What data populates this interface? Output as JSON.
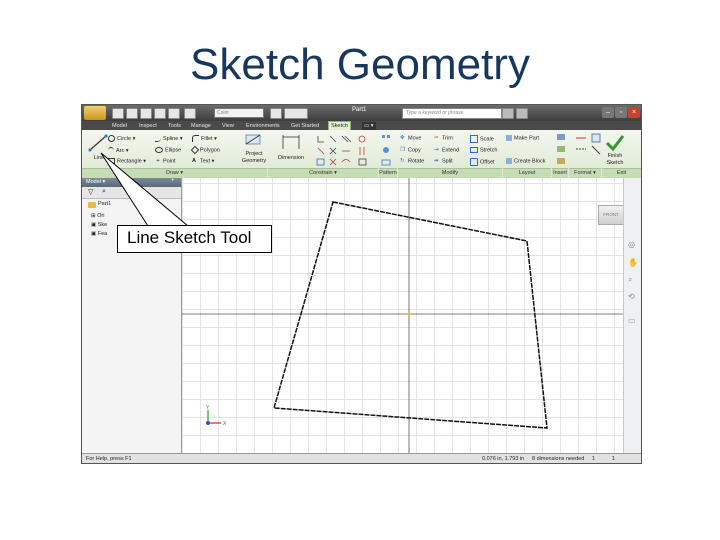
{
  "slide": {
    "title": "Sketch Geometry"
  },
  "app": {
    "doc_title": "Part1",
    "style_combo": "Color",
    "search_placeholder": "Type a keyword or phrase",
    "tabs": [
      "Model",
      "Inspect",
      "Tools",
      "Manage",
      "View",
      "Environments",
      "Get Started",
      "Sketch"
    ],
    "active_tab": "Sketch"
  },
  "ribbon": {
    "draw": {
      "line": "Line",
      "circle": "Circle",
      "arc": "Arc",
      "rectangle": "Rectangle",
      "spline": "Spline",
      "ellipse": "Ellipse",
      "point": "Point",
      "fillet": "Fillet",
      "polygon": "Polygon",
      "text": "Text",
      "project_geometry_1": "Project",
      "project_geometry_2": "Geometry"
    },
    "constrain": {
      "dimension": "Dimension"
    },
    "modify": {
      "move": "Move",
      "copy": "Copy",
      "rotate": "Rotate",
      "trim": "Trim",
      "extend": "Extend",
      "split": "Split",
      "scale": "Scale",
      "stretch": "Stretch",
      "offset": "Offset"
    },
    "layout": {
      "make_part": "Make Part",
      "create_block": "Create Block"
    },
    "exit": {
      "finish_1": "Finish",
      "finish_2": "Sketch"
    },
    "groups": {
      "draw": "Draw ▾",
      "constrain": "Constrain ▾",
      "pattern": "Pattern",
      "modify": "Modify",
      "layout": "Layout",
      "insert": "Insert",
      "format": "Format ▾",
      "exit": "Exit"
    }
  },
  "browser": {
    "title": "Model ▾",
    "root": "Part1",
    "items": [
      "Ori",
      "Ske",
      "Fea"
    ]
  },
  "viewcube": {
    "label": "FRONT"
  },
  "status": {
    "help": "For Help, press F1",
    "coords": "0.076 in, 1.793 in",
    "dimensions": "8 dimensions needed",
    "count1": "1",
    "count2": "1"
  },
  "callout": {
    "text": "Line Sketch Tool"
  },
  "colors": {
    "title": "#17375e",
    "ribbon": "#e3f0d6",
    "finish_check": "#2e9b2e",
    "axis_y": "#2e9b2e",
    "axis_x": "#d62020",
    "origin_point": "#e6c200"
  }
}
